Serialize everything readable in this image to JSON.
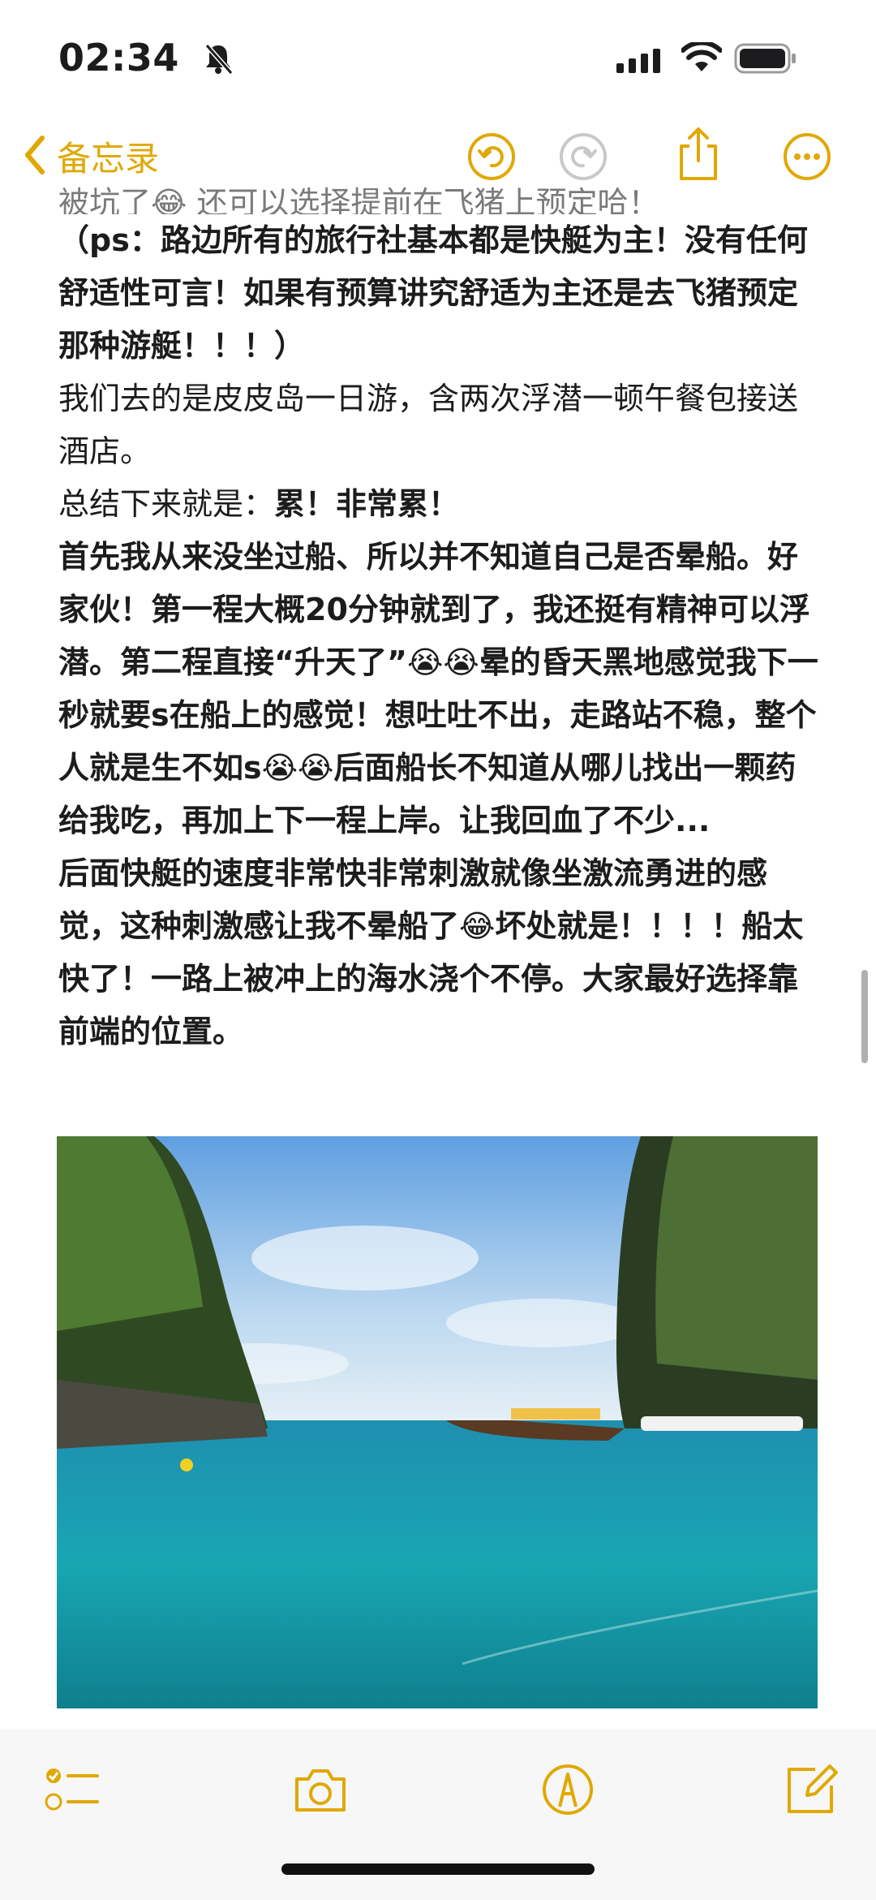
{
  "status_bar": {
    "time": "02:34",
    "icons": [
      "bell-slash-icon",
      "cellular-signal-icon",
      "wifi-icon",
      "battery-icon"
    ]
  },
  "nav": {
    "back_label": "备忘录",
    "icons": [
      "chevron-left-icon",
      "undo-icon",
      "redo-icon",
      "share-icon",
      "more-icon"
    ],
    "accent_color": "#e0a800"
  },
  "note": {
    "cut_top": "被坑了😂 还可以选择提前在飞猪上预定哈！",
    "paragraphs": [
      {
        "id": "p1",
        "text": "（ps：路边所有的旅行社基本都是快艇为主！没有任何舒适性可言！如果有预算讲究舒适为主还是去飞猪预定那种游艇！！！）",
        "bold": true
      },
      {
        "id": "p2",
        "text": "我们去的是皮皮岛一日游，含两次浮潜一顿午餐包接送酒店。",
        "bold": false
      },
      {
        "id": "p3a",
        "text": "总结下来就是：",
        "bold": false
      },
      {
        "id": "p3b",
        "text": "累！非常累！",
        "bold": true
      },
      {
        "id": "p4",
        "text": "首先我从来没坐过船、所以并不知道自己是否晕船。好家伙！第一程大概20分钟就到了，我还挺有精神可以浮潜。第二程直接“升天了”😭😭晕的昏天黑地感觉我下一秒就要s在船上的感觉！想吐吐不出，走路站不稳，整个人就是生不如s😭😭后面船长不知道从哪儿找出一颗药给我吃，再加上下一程上岸。让我回血了不少...",
        "bold": true
      },
      {
        "id": "p5",
        "text": "后面快艇的速度非常快非常刺激就像坐激流勇进的感觉，这种刺激感让我不晕船了😂坏处就是！！！！船太快了！一路上被冲上的海水浇个不停。大家最好选择靠前端的位置。",
        "bold": true
      }
    ]
  },
  "photo": {
    "subject": "turquoise-sea-with-longtail-boat",
    "colors": {
      "sky": "#7fb8e8",
      "sea": "#19a6b3",
      "cliff": "#3e5a2a"
    }
  },
  "toolbar": {
    "icons": [
      "checklist-icon",
      "camera-icon",
      "markup-pen-icon",
      "compose-icon"
    ]
  }
}
